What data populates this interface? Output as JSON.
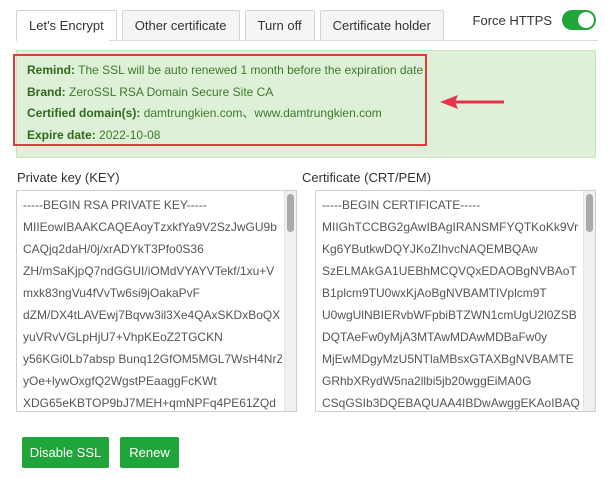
{
  "tabs": [
    {
      "label": "Let's Encrypt",
      "active": true
    },
    {
      "label": "Other certificate",
      "active": false
    },
    {
      "label": "Turn off",
      "active": false
    },
    {
      "label": "Certificate holder",
      "active": false
    }
  ],
  "force_https": {
    "label": "Force HTTPS",
    "enabled": true
  },
  "info": {
    "remind_label": "Remind:",
    "remind_text": "The SSL will be auto renewed 1 month before the expiration date",
    "brand_label": "Brand:",
    "brand_text": "ZeroSSL RSA Domain Secure Site CA",
    "domains_label": "Certified domain(s):",
    "domains_text": "damtrungkien.com、www.damtrungkien.com",
    "expire_label": "Expire date:",
    "expire_text": "2022-10-08"
  },
  "private_key": {
    "label": "Private key (KEY)",
    "lines": [
      "-----BEGIN RSA PRIVATE KEY-----",
      "MIIEowIBAAKCAQEAoyTzxkfYa9V2SzJwGU9b",
      "CAQjq2daH/0j/xrADYkT3Pfo0S36",
      "ZH/mSaKjpQ7ndGGUI/iOMdVYAYVTekf/1xu+V",
      "mxk83ngVu4fVvTw6si9jOakaPvF",
      "dZM/DX4tLAVEwj7Bqvw3il3Xe4QAxSKDxBoQX",
      "yuVRvVGLpHjU7+VhpKEoZ2TGCKN",
      "y56KGi0Lb7absp Bunq12GfOM5MGL7WsH4NrZ",
      "yOe+lywOxgfQ2WgstPEaaggFcKWt",
      "XDG65eKBTOP9bJ7MEH+qmNPFq4PE61ZQd"
    ]
  },
  "certificate": {
    "label": "Certificate (CRT/PEM)",
    "lines": [
      "-----BEGIN CERTIFICATE-----",
      "MIIGhTCCBG2gAwIBAgIRANSMFYQTKoKk9Vr",
      "Kg6YButkwDQYJKoZIhvcNAQEMBQAw",
      "SzELMAkGA1UEBhMCQVQxEDAOBgNVBAoT",
      "B1plcm9TU0wxKjAoBgNVBAMTIVplcm9T",
      "U0wgUlNBIERvbWFpbiBTZWN1cmUgU2l0ZSB",
      "DQTAeFw0yMjA3MTAwMDAwMDBaFw0y",
      "MjEwMDgyMzU5NTlaMBsxGTAXBgNVBAMTE",
      "GRhbXRydW5na2llbi5jb20wggEiMA0G",
      "CSqGSIb3DQEBAQUAA4IBDwAwggEKAoIBAQ"
    ]
  },
  "buttons": {
    "disable_ssl": "Disable SSL",
    "renew": "Renew"
  },
  "colors": {
    "accent": "#20a53a",
    "highlight": "#e03a3a",
    "info_bg": "#dff0d8",
    "info_text": "#3d7a2a"
  }
}
